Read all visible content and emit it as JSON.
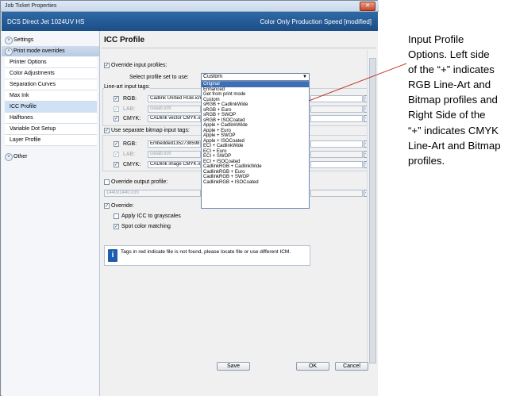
{
  "window": {
    "title": "Job Ticket Properties",
    "close_glyph": "✕",
    "printer": "DCS Direct Jet 1024UV HS",
    "mode": "Color Only Production Speed [modified]"
  },
  "sidebar": {
    "settings": "Settings",
    "print_mode_overrides": "Print mode overrides",
    "items": [
      {
        "label": "Printer Options"
      },
      {
        "label": "Color Adjustments"
      },
      {
        "label": "Separation Curves"
      },
      {
        "label": "Max Ink"
      },
      {
        "label": "ICC Profile"
      },
      {
        "label": "Halftones"
      },
      {
        "label": "Variable Dot Setup"
      },
      {
        "label": "Layer Profile"
      }
    ],
    "other": "Other",
    "chevron_up": "˄",
    "chevron_down": "˅"
  },
  "content": {
    "title": "ICC Profile",
    "override_input": "Override input profiles:",
    "select_label": "Select profile set to use:",
    "selected_value": "Custom",
    "lineart_label": "Line-art input tags:",
    "lineart": {
      "rgb_label": "RGB:",
      "rgb_value": "Cadlink Unified RGB.icm",
      "lab_label": "LAB:",
      "lab_value": "cielab.icm",
      "cmyk_label": "CMYK:",
      "cmyk_value": "CADlink vector CMYK.icm"
    },
    "bitmap_label": "Use separate bitmap input tags:",
    "bitmap": {
      "rgb_label": "RGB:",
      "rgb_value": "Embedded1352738598",
      "lab_label": "LAB:",
      "lab_value": "cielab.icm",
      "cmyk_label": "CMYK:",
      "cmyk_value": "CADlink image CMYK.icm"
    },
    "override_output": "Override output profile:",
    "output_value": "1440x1440.icm",
    "override": "Override:",
    "apply_icc_grayscales": "Apply ICC to grayscales",
    "spot_color_matching": "Spot color matching",
    "info_text": "Tags in red indicate file is not found, please locate file or use different ICM.",
    "info_icon": "i",
    "check_glyph": "✓",
    "dots_glyph": "···",
    "arrow_glyph": "▼"
  },
  "dropdown_options": [
    "Original",
    "Enhanced",
    "Get from print mode",
    "Custom",
    "sRGB + CadlinkWide",
    "sRGB + Euro",
    "sRGB + SWOP",
    "sRGB + ISOCoated",
    "Apple + CadlinkWide",
    "Apple + Euro",
    "Apple + SWOP",
    "Apple + ISOCoated",
    "ECI + CadlinkWide",
    "ECI + Euro",
    "ECI + SWOP",
    "ECI + ISOCoated",
    "CadlinkRGB + CadlinkWide",
    "CadlinkRGB + Euro",
    "CadlinkRGB + SWOP",
    "CadlinkRGB + ISOCoated"
  ],
  "buttons": {
    "save": "Save",
    "ok": "OK",
    "cancel": "Cancel"
  },
  "annotation": [
    "Input Profile",
    "Options.  Left side",
    "of the “+” indicates",
    "RGB Line-Art and",
    "Bitmap profiles and",
    "Right Side of the",
    "“+” indicates CMYK",
    "Line-Art and Bitmap",
    "profiles."
  ],
  "colors": {
    "header": "#2f6aa6",
    "annotation_line": "#c0392b",
    "selection": "#3c6fb8"
  }
}
